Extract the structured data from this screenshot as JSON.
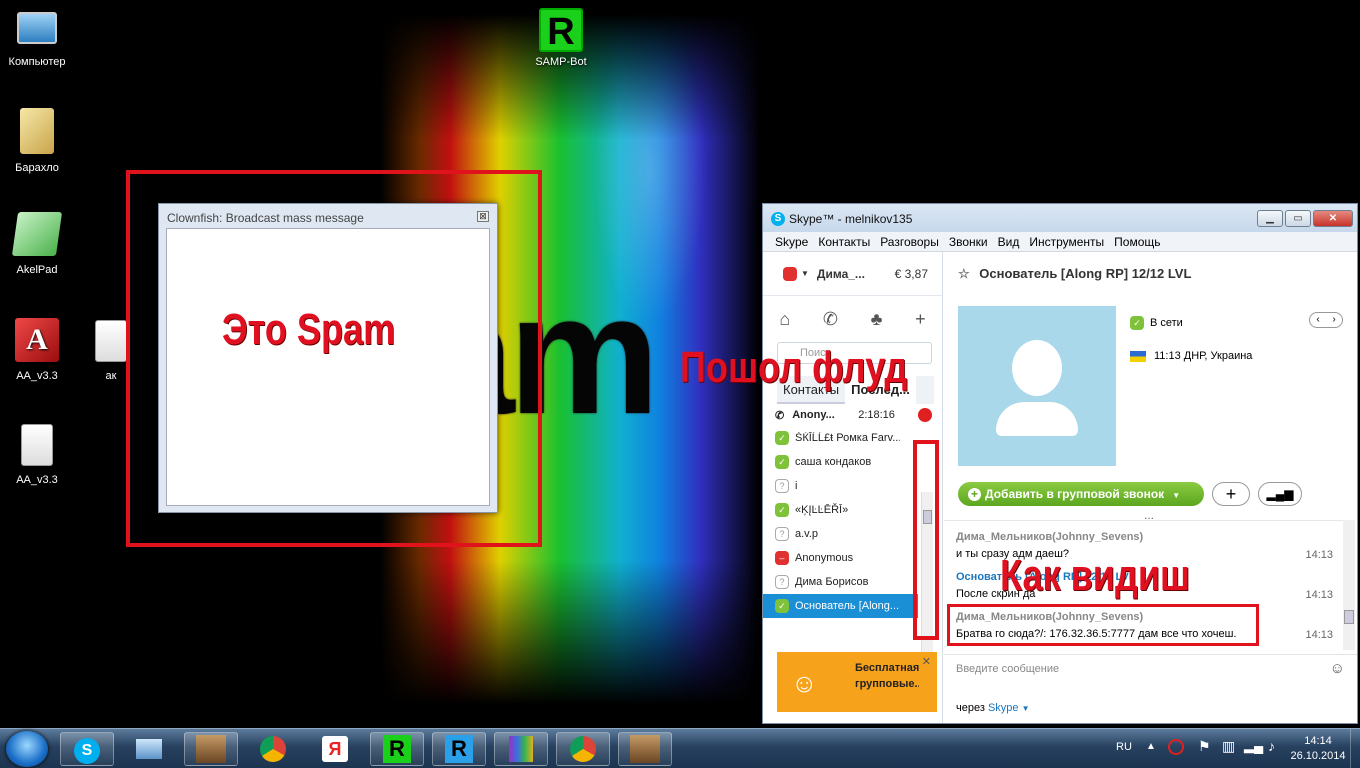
{
  "desktop": {
    "icons": [
      {
        "label": "Компьютер"
      },
      {
        "label": "SAMP-Bot",
        "glyph": "R"
      },
      {
        "label": "Барахло"
      },
      {
        "label": "AkelPad"
      },
      {
        "label": "AA_v3.3"
      },
      {
        "label": "ак"
      },
      {
        "label": "AA_v3.3"
      }
    ],
    "wallpaper_word": "am"
  },
  "annotations": {
    "spam": "Это Spam",
    "flood": "Пошол флуд",
    "see": "Как видиш"
  },
  "clownfish": {
    "title": "Clownfish: Broadcast mass message",
    "close": "⊠"
  },
  "skype": {
    "title": "Skype™ - melnikov135",
    "menu": [
      "Skype",
      "Контакты",
      "Разговоры",
      "Звонки",
      "Вид",
      "Инструменты",
      "Помощь"
    ],
    "account": {
      "name": "Дима_...",
      "balance": "€ 3,87"
    },
    "search_placeholder": "Поиск",
    "tabs": {
      "contacts": "Контакты",
      "recent": "Послед..."
    },
    "recent_call": {
      "name": "Anony...",
      "duration": "2:18:16"
    },
    "contacts": [
      {
        "name": "ŠЌĪĹĹ£ŧ Ромка Farv..."
      },
      {
        "name": "саша кондаков"
      },
      {
        "name": "i"
      },
      {
        "name": "«ĶĮĿĿĒŘĪ»"
      },
      {
        "name": "a.v.p"
      },
      {
        "name": "Anonymous"
      },
      {
        "name": "Дима Борисов"
      },
      {
        "name": "Основатель [Along..."
      }
    ],
    "promo": {
      "text": "Бесплатная групповые..."
    },
    "chat": {
      "header": "Основатель [Along RP] 12/12 LVL",
      "status": "В сети",
      "location": "11:13 ДНР, Украина",
      "group_call_button": "Добавить в групповой звонок",
      "more": "...",
      "messages": [
        {
          "author": "Дима_Мельников(Johnny_Sevens)",
          "text": "и ты сразу адм даеш?",
          "time": "14:13"
        },
        {
          "author": "Основатель [Along RP] 12/12 LVL",
          "text": "После скрин да",
          "time": "14:13"
        },
        {
          "author": "Дима_Мельников(Johnny_Sevens)",
          "text": "Братва го сюда?/: 176.32.36.5:7777 дам все что хочеш.",
          "time": "14:13"
        }
      ],
      "input_placeholder": "Введите сообщение",
      "via_label": "через",
      "via_value": "Skype"
    }
  },
  "taskbar": {
    "lang": "RU",
    "time": "14:14",
    "date": "26.10.2014"
  }
}
